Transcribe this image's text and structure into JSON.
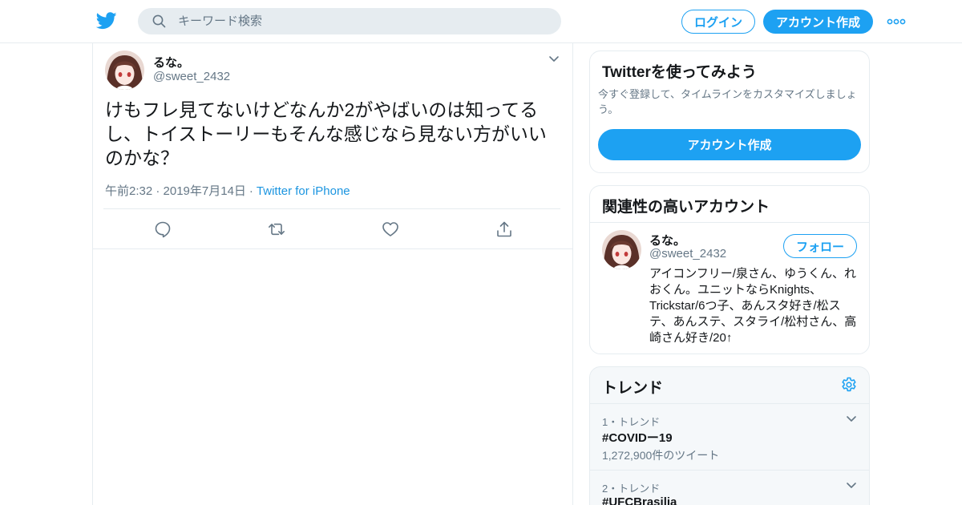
{
  "header": {
    "search_placeholder": "キーワード検索",
    "login_label": "ログイン",
    "signup_label": "アカウント作成"
  },
  "tweet": {
    "display_name": "るな。",
    "handle": "@sweet_2432",
    "text": "けもフレ見てないけどなんか2がやばいのは知ってるし、トイストーリーもそんな感じなら見ない方がいいのかな？",
    "timestamp": "午前2:32 · 2019年7月14日",
    "separator": "·",
    "source": "Twitter for iPhone"
  },
  "signup_card": {
    "title": "Twitterを使ってみよう",
    "description": "今すぐ登録して、タイムラインをカスタマイズしましょう。",
    "button_label": "アカウント作成"
  },
  "related_card": {
    "title": "関連性の高いアカウント",
    "display_name": "るな。",
    "handle": "@sweet_2432",
    "follow_label": "フォロー",
    "bio": "アイコンフリー/泉さん、ゆうくん、れおくん。ユニットならKnights、Trickstar/6つ子、あんスタ好き/松ステ、あんステ、スタライ/松村さん、高崎さん好き/20↑"
  },
  "trends_card": {
    "title": "トレンド",
    "items": [
      {
        "rank": "1・トレンド",
        "name": "#COVIDー19",
        "count": "1,272,900件のツイート"
      },
      {
        "rank": "2・トレンド",
        "name": "#UFCBrasilia",
        "count": ""
      }
    ]
  },
  "colors": {
    "brand": "#1da1f2",
    "link": "#1b95e0",
    "secondary_text": "#657786",
    "border": "#e6ecf0"
  },
  "icons": [
    "twitter-bird-icon",
    "search-icon",
    "more-dots-icon",
    "chevron-down-icon",
    "reply-icon",
    "retweet-icon",
    "like-heart-icon",
    "share-icon",
    "gear-icon"
  ]
}
